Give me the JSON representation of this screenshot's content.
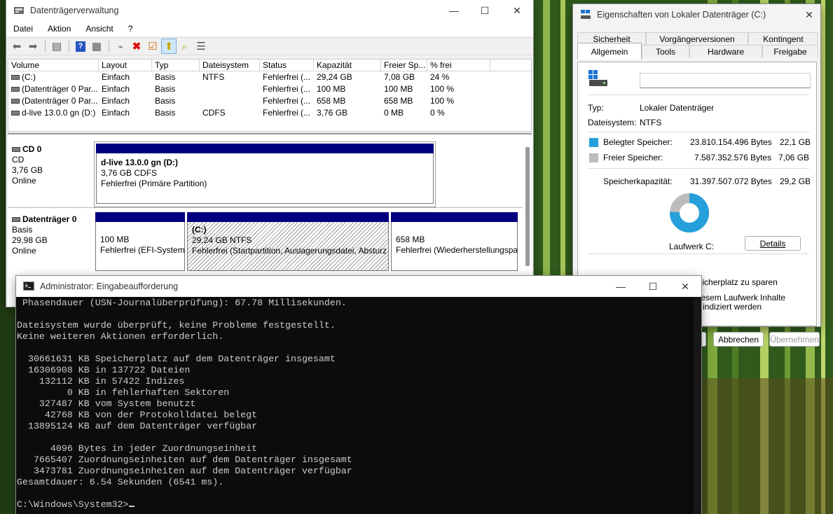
{
  "disk_management": {
    "title": "Datenträgerverwaltung",
    "menu": [
      "Datei",
      "Aktion",
      "Ansicht",
      "?"
    ],
    "toolbar_icons": [
      "back-icon",
      "forward-icon",
      "console-tree-icon",
      "help-icon",
      "properties-icon",
      "connect-icon",
      "delete-icon",
      "check-icon",
      "rescan-icon",
      "search-icon",
      "list-icon"
    ],
    "columns": [
      "Volume",
      "Layout",
      "Typ",
      "Dateisystem",
      "Status",
      "Kapazität",
      "Freier Sp...",
      "% frei"
    ],
    "volumes": [
      {
        "name": "(C:)",
        "layout": "Einfach",
        "type": "Basis",
        "fs": "NTFS",
        "status": "Fehlerfrei (...",
        "capacity": "29,24 GB",
        "free": "7,08 GB",
        "pct": "24 %"
      },
      {
        "name": "(Datenträger 0 Par...",
        "layout": "Einfach",
        "type": "Basis",
        "fs": "",
        "status": "Fehlerfrei (...",
        "capacity": "100 MB",
        "free": "100 MB",
        "pct": "100 %"
      },
      {
        "name": "(Datenträger 0 Par...",
        "layout": "Einfach",
        "type": "Basis",
        "fs": "",
        "status": "Fehlerfrei (...",
        "capacity": "658 MB",
        "free": "658 MB",
        "pct": "100 %"
      },
      {
        "name": "d-live 13.0.0 gn (D:)",
        "layout": "Einfach",
        "type": "Basis",
        "fs": "CDFS",
        "status": "Fehlerfrei (...",
        "capacity": "3,76 GB",
        "free": "0 MB",
        "pct": "0 %"
      }
    ],
    "cd0": {
      "name": "CD 0",
      "type": "CD",
      "size": "3,76 GB",
      "state": "Online",
      "partition": {
        "title": "d-live 13.0.0 gn  (D:)",
        "line2": "3,76 GB CDFS",
        "line3": "Fehlerfrei (Primäre Partition)"
      }
    },
    "disk0": {
      "name": "Datenträger 0",
      "type": "Basis",
      "size": "29,98 GB",
      "state": "Online",
      "partitions": [
        {
          "title": "",
          "line2": "100 MB",
          "line3": "Fehlerfrei (EFI-System"
        },
        {
          "title": "(C:)",
          "line2": "29,24 GB NTFS",
          "line3": "Fehlerfrei (Startpartition, Auslagerungsdatei, Absturz"
        },
        {
          "title": "",
          "line2": "658 MB",
          "line3": "Fehlerfrei (Wiederherstellungspa"
        }
      ]
    }
  },
  "properties": {
    "title": "Eigenschaften von Lokaler Datenträger (C:)",
    "tabs_back": [
      "Sicherheit",
      "Vorgängerversionen",
      "Kontingent"
    ],
    "tabs_front": [
      "Allgemein",
      "Tools",
      "Hardware",
      "Freigabe"
    ],
    "name_value": "",
    "type_label": "Typ:",
    "type_value": "Lokaler Datenträger",
    "fs_label": "Dateisystem:",
    "fs_value": "NTFS",
    "used_label": "Belegter Speicher:",
    "used_bytes": "23.810.154.496 Bytes",
    "used_gb": "22,1 GB",
    "free_label": "Freier Speicher:",
    "free_bytes": "7.587.352.576 Bytes",
    "free_gb": "7,06 GB",
    "cap_label": "Speicherkapazität:",
    "cap_bytes": "31.397.507.072 Bytes",
    "cap_gb": "29,2 GB",
    "used_fraction": 0.758,
    "drive_label": "Laufwerk C:",
    "details_button": "Details",
    "compress_text": "peicherplatz zu sparen",
    "index_text_1": "diesem Laufwerk Inhalte",
    "index_text_2": "n indiziert werden",
    "ok_button": "",
    "cancel_button": "Abbrechen",
    "apply_button": "Übernehmen",
    "colors": {
      "used": "#26a0da",
      "free": "#bcbcbc"
    }
  },
  "cmd": {
    "title": "Administrator: Eingabeaufforderung",
    "lines": [
      " Phasendauer (USN-Journalüberprüfung): 67.78 Millisekunden.",
      "",
      "Dateisystem wurde überprüft, keine Probleme festgestellt.",
      "Keine weiteren Aktionen erforderlich.",
      "",
      "  30661631 KB Speicherplatz auf dem Datenträger insgesamt",
      "  16306908 KB in 137722 Dateien",
      "    132112 KB in 57422 Indizes",
      "         0 KB in fehlerhaften Sektoren",
      "    327487 KB vom System benutzt",
      "     42768 KB von der Protokolldatei belegt",
      "  13895124 KB auf dem Datenträger verfügbar",
      "",
      "      4096 Bytes in jeder Zuordnungseinheit",
      "   7665407 Zuordnungseinheiten auf dem Datenträger insgesamt",
      "   3473781 Zuordnungseinheiten auf dem Datenträger verfügbar",
      "Gesamtdauer: 6.54 Sekunden (6541 ms).",
      ""
    ],
    "prompt": "C:\\Windows\\System32>"
  }
}
